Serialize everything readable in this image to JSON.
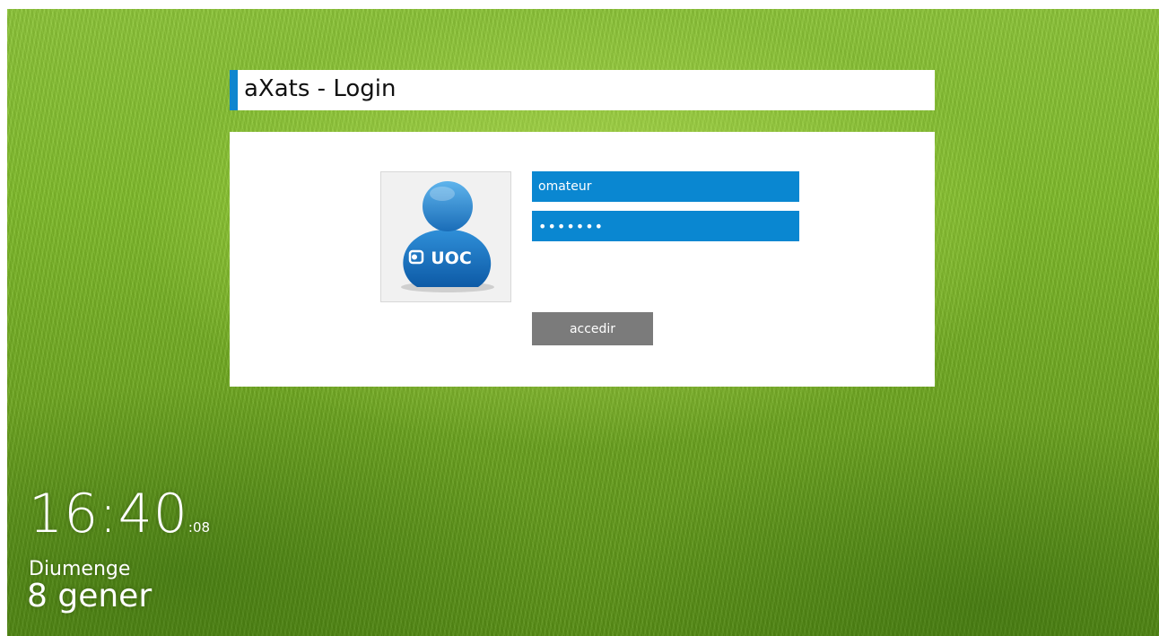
{
  "app": {
    "title": "aXats - Login",
    "accent_color": "#0f86cf"
  },
  "login": {
    "avatar_icon": "uoc-user-avatar-icon",
    "avatar_text": "UOC",
    "username_value": "omateur",
    "password_value": "•••••••",
    "submit_label": "accedir"
  },
  "clock": {
    "time": "16:40",
    "seconds": ":08",
    "day_name": "Diumenge",
    "date": "8 gener"
  }
}
